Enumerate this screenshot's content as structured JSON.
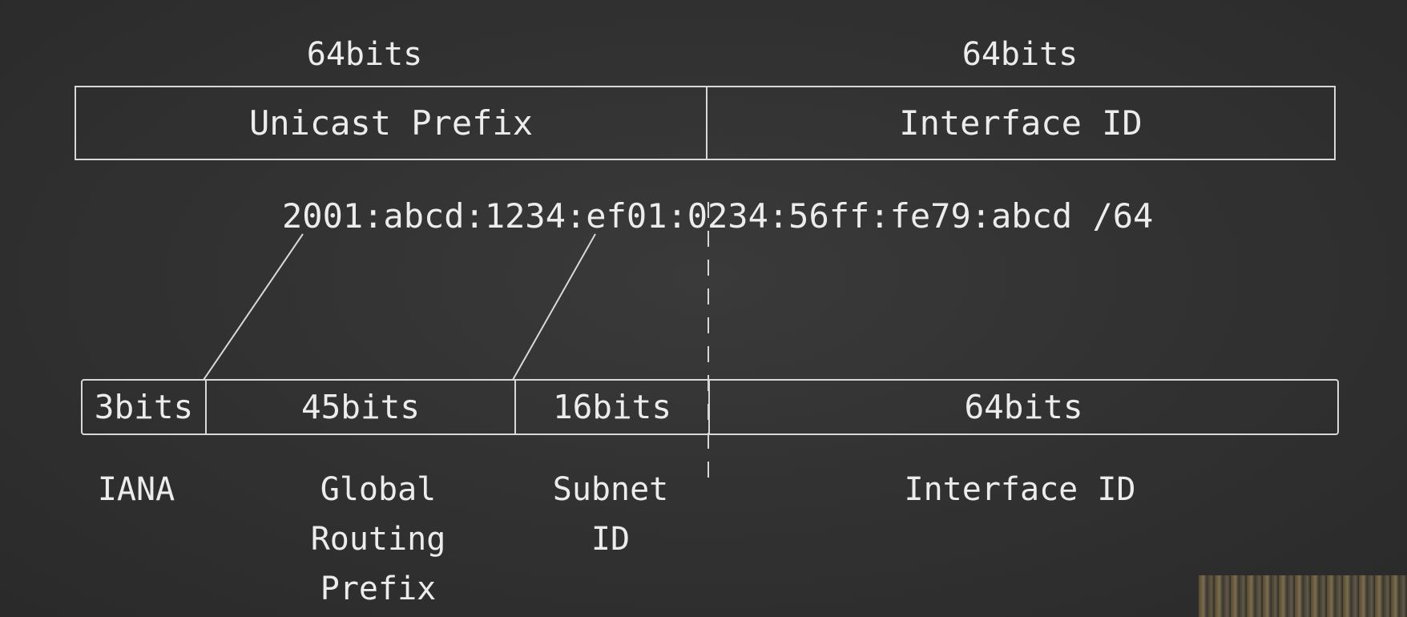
{
  "top": {
    "left_bits": "64bits",
    "right_bits": "64bits",
    "left_box": "Unicast Prefix",
    "right_box": "Interface ID"
  },
  "address": "2001:abcd:1234:ef01:0234:56ff:fe79:abcd /64",
  "bottom": {
    "segments": [
      {
        "bits": "3bits",
        "name": "IANA"
      },
      {
        "bits": "45bits",
        "name_lines": [
          "Global",
          "Routing",
          "Prefix"
        ]
      },
      {
        "bits": "16bits",
        "name_lines": [
          "Subnet",
          "ID"
        ]
      },
      {
        "bits": "64bits",
        "name": "Interface ID"
      }
    ]
  }
}
